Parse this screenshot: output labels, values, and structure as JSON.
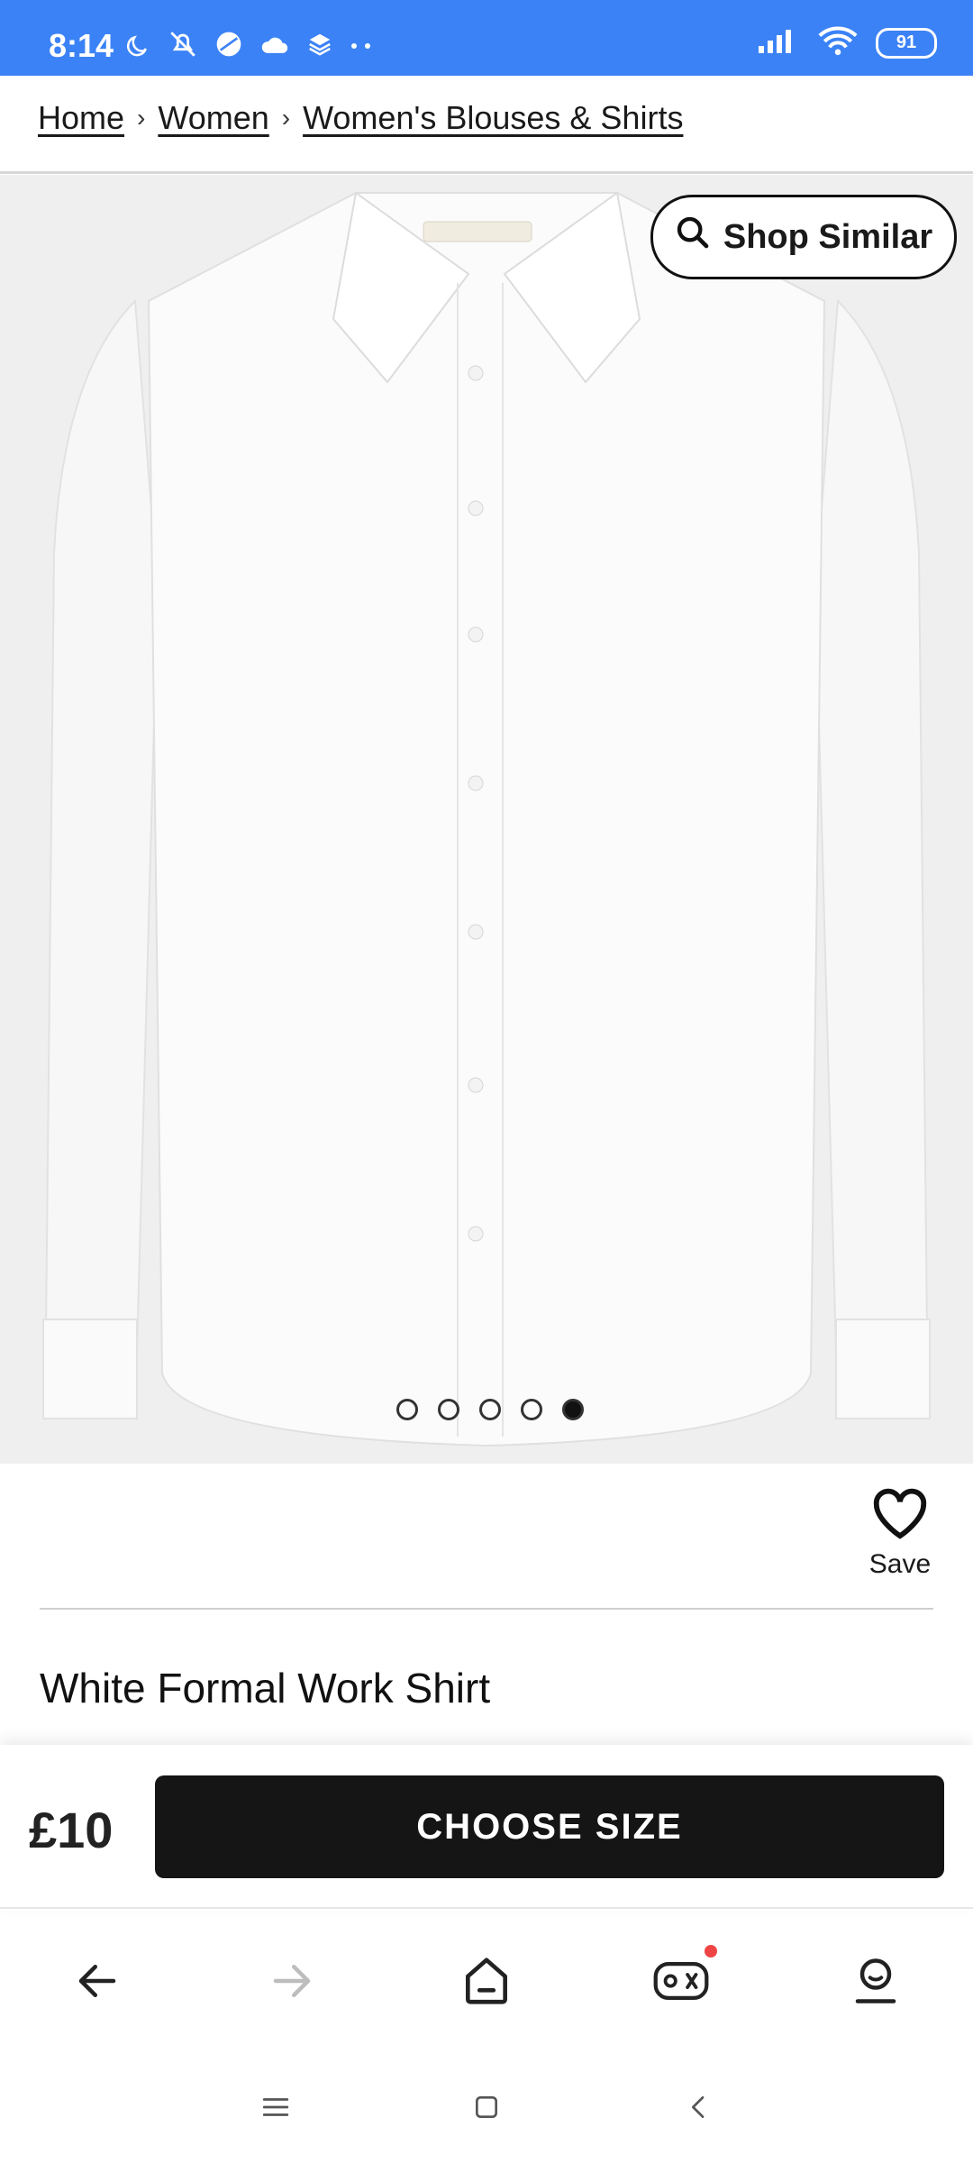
{
  "status_bar": {
    "time": "8:14",
    "battery": "91",
    "icons": [
      "moon-icon",
      "mute-icon",
      "circle-icon",
      "cloud-icon",
      "layers-icon",
      "more-dots-icon"
    ],
    "right_icons": [
      "signal-icon",
      "wifi-icon",
      "battery-icon"
    ]
  },
  "breadcrumb": {
    "items": [
      "Home",
      "Women",
      "Women's Blouses & Shirts"
    ],
    "separator": "›"
  },
  "product": {
    "shop_similar_label": "Shop Similar",
    "image_dots_total": 5,
    "image_dots_active_index": 4,
    "save_label": "Save",
    "title": "White Formal Work Shirt"
  },
  "sticky_bar": {
    "price": "£10",
    "choose_size_label": "CHOOSE SIZE"
  },
  "browser_nav": {
    "icons": [
      "back-arrow-icon",
      "forward-arrow-icon",
      "home-icon",
      "games-icon",
      "profile-icon"
    ]
  },
  "system_nav": {
    "icons": [
      "menu-icon",
      "home-square-icon",
      "back-chevron-icon"
    ]
  },
  "colors": {
    "status_bar": "#3b82f6",
    "button_dark": "#151515",
    "badge": "#ef4444"
  }
}
